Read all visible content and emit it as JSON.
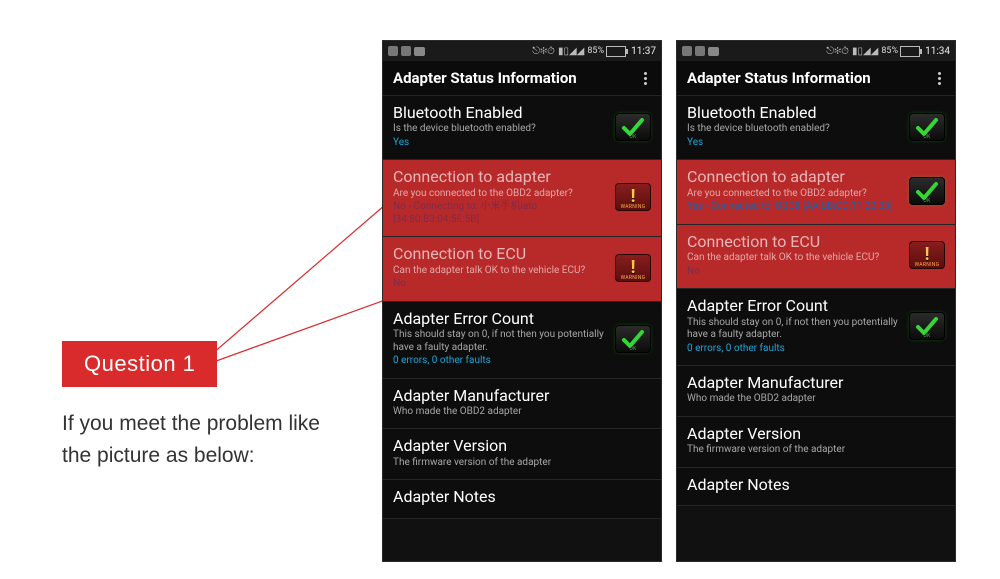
{
  "left": {
    "badge": "Question 1",
    "body": "If you meet the prob­lem like the picture as below:"
  },
  "status_icons": {
    "ok_label": "OK",
    "warn_label": "WARNING"
  },
  "phones": [
    {
      "statusbar": {
        "battery": "85%",
        "time": "11:37"
      },
      "appbar_title": "Adapter Status Information",
      "rows": [
        {
          "kind": "ok",
          "highlight": false,
          "title": "Bluetooth Enabled",
          "sub": "Is the device bluetooth enabled?",
          "detail": "Yes"
        },
        {
          "kind": "warn",
          "highlight": true,
          "title": "Connection to adapter",
          "sub": "Are you connected to the OBD2 adapter?",
          "detail": "No - Connecting to: 小米手机iato\n[34:80:B3:04:5E:5B]"
        },
        {
          "kind": "warn",
          "highlight": true,
          "title": "Connection to ECU",
          "sub": "Can the adapter talk OK to the vehicle ECU?",
          "detail": "No"
        },
        {
          "kind": "ok",
          "highlight": false,
          "title": "Adapter Error Count",
          "sub": "This should stay on 0, if not then you potentially have a faulty adapter.",
          "detail": "0 errors, 0 other faults"
        },
        {
          "kind": "none",
          "highlight": false,
          "title": "Adapter Manufacturer",
          "sub": "Who made the OBD2 adapter",
          "detail": ""
        },
        {
          "kind": "none",
          "highlight": false,
          "title": "Adapter Version",
          "sub": "The firmware version of the adapter",
          "detail": ""
        },
        {
          "kind": "none",
          "highlight": false,
          "title": "Adapter Notes",
          "sub": "",
          "detail": ""
        }
      ]
    },
    {
      "statusbar": {
        "battery": "85%",
        "time": "11:34"
      },
      "appbar_title": "Adapter Status Information",
      "rows": [
        {
          "kind": "ok",
          "highlight": false,
          "title": "Bluetooth Enabled",
          "sub": "Is the device bluetooth enabled?",
          "detail": "Yes"
        },
        {
          "kind": "ok",
          "highlight": true,
          "bright_detail": true,
          "title": "Connection to adapter",
          "sub": "Are you connected to the OBD2 adapter?",
          "detail": "Yes - Connected to: OBDII [AA:BB:CC:11:22:33]"
        },
        {
          "kind": "warn",
          "highlight": true,
          "title": "Connection to ECU",
          "sub": "Can the adapter talk OK to the vehicle ECU?",
          "detail": "No"
        },
        {
          "kind": "ok",
          "highlight": false,
          "title": "Adapter Error Count",
          "sub": "This should stay on 0, if not then you potentially have a faulty adapter.",
          "detail": "0 errors, 0 other faults"
        },
        {
          "kind": "none",
          "highlight": false,
          "title": "Adapter Manufacturer",
          "sub": "Who made the OBD2 adapter",
          "detail": ""
        },
        {
          "kind": "none",
          "highlight": false,
          "title": "Adapter Version",
          "sub": "The firmware version of the adapter",
          "detail": ""
        },
        {
          "kind": "none",
          "highlight": false,
          "title": "Adapter Notes",
          "sub": "",
          "detail": ""
        }
      ]
    }
  ]
}
